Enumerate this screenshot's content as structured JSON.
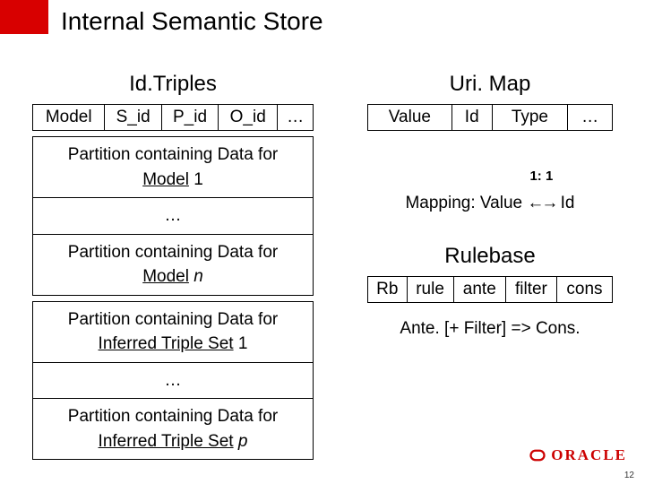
{
  "title": "Internal Semantic Store",
  "left": {
    "heading": "Id.Triples",
    "cols": [
      "Model",
      "S_id",
      "P_id",
      "O_id",
      "…"
    ],
    "rows": [
      {
        "pre": "Partition containing Data for ",
        "mid": "Model",
        "suf": " 1"
      },
      {
        "pre": "",
        "mid": "…",
        "suf": ""
      },
      {
        "pre": "Partition containing Data for ",
        "mid": "Model",
        "suf": " n"
      },
      {
        "pre": "Partition containing Data for ",
        "mid": "Inferred Triple Set",
        "suf": " 1"
      },
      {
        "pre": "",
        "mid": "…",
        "suf": ""
      },
      {
        "pre": "Partition containing Data for ",
        "mid": "Inferred Triple Set",
        "suf": " p"
      }
    ]
  },
  "right": {
    "heading1": "Uri. Map",
    "cols1": [
      "Value",
      "Id",
      "Type",
      "…"
    ],
    "mapping_pre": "Mapping: Value ",
    "mapping_ratio": "1: 1",
    "mapping_post": " Id",
    "heading2": "Rulebase",
    "cols2": [
      "Rb",
      "rule",
      "ante",
      "filter",
      "cons"
    ],
    "rulenote": "Ante. [+ Filter] => Cons."
  },
  "footer_brand": "ORACLE",
  "page": "12"
}
